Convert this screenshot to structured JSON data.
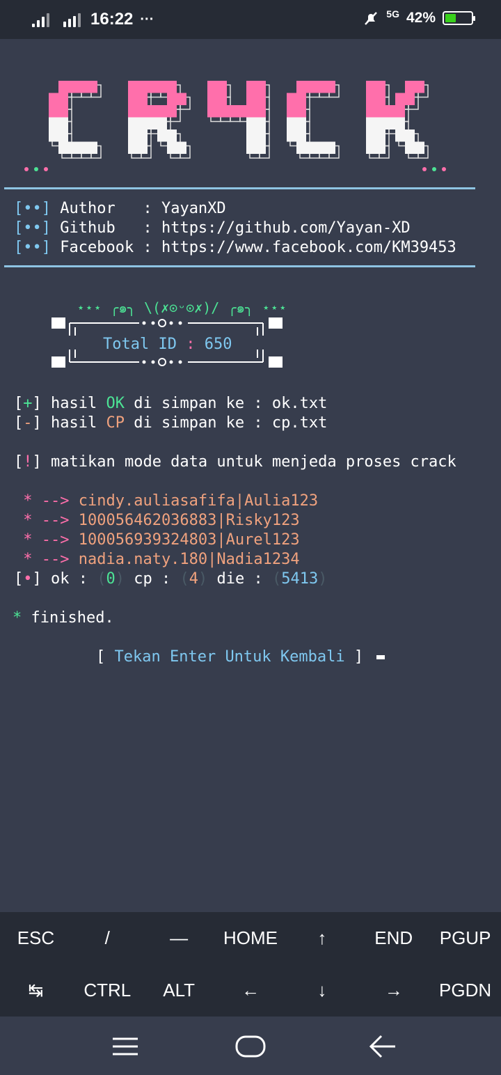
{
  "status_bar": {
    "time": "16:22",
    "more_indicator": "···",
    "network_label": "5G",
    "battery_percent": "42%",
    "battery_level": 0.42,
    "icons": [
      "signal-strength-icon",
      "signal-strength-icon",
      "muted-bell-icon",
      "battery-icon"
    ]
  },
  "terminal": {
    "logo_text": "CR4CK",
    "colors": {
      "pink": "#ff6fab",
      "white": "#f5f5f5",
      "blue": "#7fc8f0",
      "green": "#4ce395",
      "orange": "#f0a27e"
    },
    "info": [
      {
        "prefix": "[••]",
        "label": "Author  ",
        "sep": ":",
        "value": "YayanXD"
      },
      {
        "prefix": "[••]",
        "label": "Github  ",
        "sep": ":",
        "value": "https://github.com/Yayan-XD"
      },
      {
        "prefix": "[••]",
        "label": "Facebook",
        "sep": ":",
        "value": "https://www.facebook.com/KM39453"
      }
    ],
    "box": {
      "kaomoji": "⋆⋆⋆ ╭๑╮ \\(✗⊙ᵕ⊙✗)/ ╭๑╮ ⋆⋆⋆",
      "label": "Total ID",
      "sep": ":",
      "value": "650"
    },
    "save_lines": [
      {
        "bracket_open": "[",
        "symbol": "+",
        "bracket_close": "]",
        "pre": "hasil",
        "tag": "OK",
        "post": "di simpan ke :",
        "file": "ok.txt"
      },
      {
        "bracket_open": "[",
        "symbol": "-",
        "bracket_close": "]",
        "pre": "hasil",
        "tag": "CP",
        "post": "di simpan ke :",
        "file": "cp.txt"
      }
    ],
    "warning": {
      "symbol": "!",
      "text": "matikan mode data untuk menjeda proses crack"
    },
    "results": [
      "cindy.auliasafifa|Aulia123",
      "100056462036883|Risky123",
      "100056939324803|Aurel123",
      "nadia.naty.180|Nadia1234"
    ],
    "result_prefix": "* -->",
    "stats": {
      "ok_label": "ok",
      "ok": "0",
      "cp_label": "cp",
      "cp": "4",
      "die_label": "die",
      "die": "5413"
    },
    "finished": "finished.",
    "prompt": "Tekan Enter Untuk Kembali"
  },
  "extra_keys": {
    "row1": [
      "ESC",
      "/",
      "—",
      "HOME",
      "↑",
      "END",
      "PGUP"
    ],
    "row2": [
      "↹",
      "CTRL",
      "ALT",
      "←",
      "↓",
      "→",
      "PGDN"
    ]
  },
  "navbar": {
    "icons": [
      "menu-icon",
      "home-icon",
      "back-icon"
    ]
  }
}
